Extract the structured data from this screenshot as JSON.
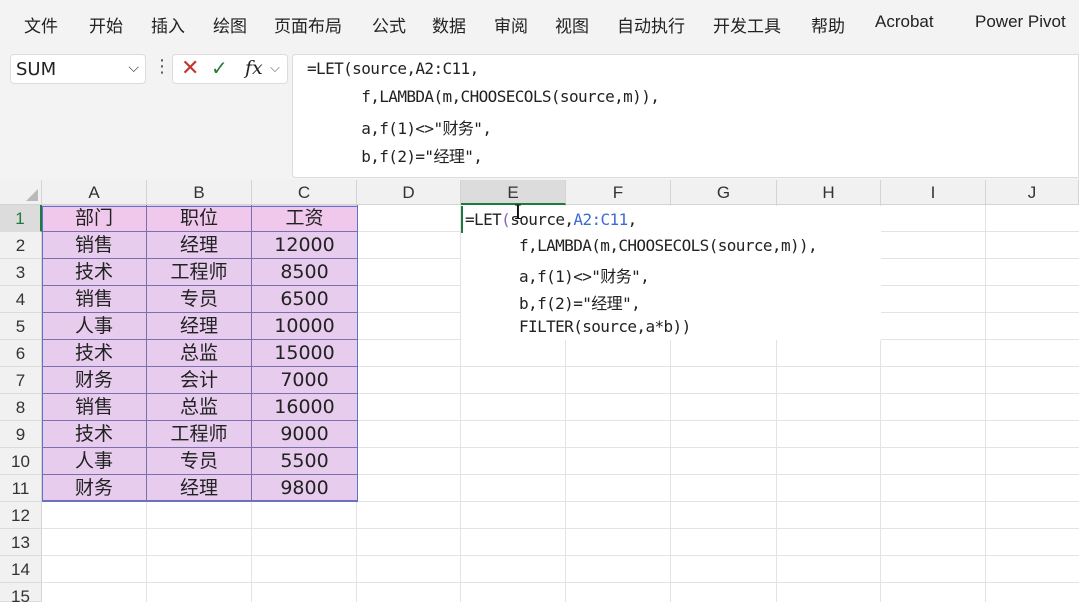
{
  "ribbon": {
    "menu": [
      "文件",
      "开始",
      "插入",
      "绘图",
      "页面布局",
      "公式",
      "数据",
      "审阅",
      "视图",
      "自动执行",
      "开发工具",
      "帮助",
      "Acrobat",
      "Power Pivot"
    ]
  },
  "formula_bar": {
    "name_box": "SUM",
    "fx_label": "fx",
    "formula_lines": [
      "=LET(source,A2:C11,",
      "      f,LAMBDA(m,CHOOSECOLS(source,m)),",
      "      a,f(1)<>\"财务\",",
      "      b,f(2)=\"经理\","
    ]
  },
  "sheet": {
    "columns": [
      "A",
      "B",
      "C",
      "D",
      "E",
      "F",
      "G",
      "H",
      "I",
      "J"
    ],
    "active_column": "E",
    "rows": [
      "1",
      "2",
      "3",
      "4",
      "5",
      "6",
      "7",
      "8",
      "9",
      "10",
      "11",
      "12",
      "13",
      "14",
      "15"
    ],
    "active_row": "1",
    "table": {
      "headers": [
        "部门",
        "职位",
        "工资"
      ],
      "rows": [
        [
          "销售",
          "经理",
          "12000"
        ],
        [
          "技术",
          "工程师",
          "8500"
        ],
        [
          "销售",
          "专员",
          "6500"
        ],
        [
          "人事",
          "经理",
          "10000"
        ],
        [
          "技术",
          "总监",
          "15000"
        ],
        [
          "财务",
          "会计",
          "7000"
        ],
        [
          "销售",
          "总监",
          "16000"
        ],
        [
          "技术",
          "工程师",
          "9000"
        ],
        [
          "人事",
          "专员",
          "5500"
        ],
        [
          "财务",
          "经理",
          "9800"
        ]
      ]
    },
    "editing_cell": {
      "line1_start": "=LET",
      "line1_paren": "(",
      "line1_mid": "source,",
      "line1_ref": "A2:C11",
      "line1_end": ",",
      "line2": "f,LAMBDA(m,CHOOSECOLS(source,m)),",
      "line3": "a,f(1)<>\"财务\",",
      "line4": "b,f(2)=\"经理\",",
      "line5": "FILTER(source,a*b))"
    }
  },
  "colors": {
    "header_fill": "#efc8ec",
    "data_fill": "#e7ccee",
    "active_green": "#1f7a3e",
    "reference_blue": "#3d6bd6"
  }
}
